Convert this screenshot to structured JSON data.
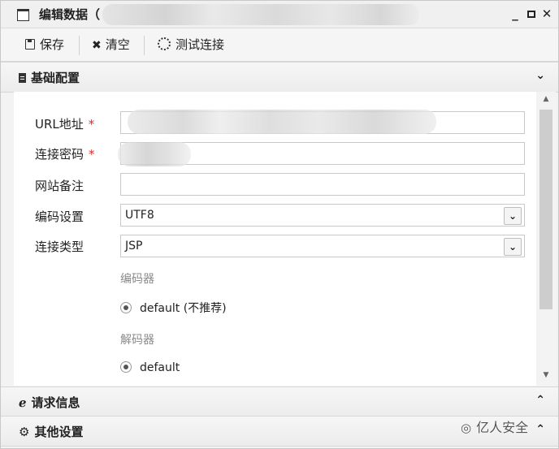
{
  "window": {
    "title": "编辑数据（"
  },
  "toolbar": {
    "save_label": "保存",
    "clear_label": "清空",
    "test_label": "测试连接"
  },
  "sections": {
    "basic": "基础配置",
    "request": "请求信息",
    "other": "其他设置"
  },
  "form": {
    "url_label": "URL地址",
    "password_label": "连接密码",
    "note_label": "网站备注",
    "encoding_label": "编码设置",
    "encoding_value": "UTF8",
    "type_label": "连接类型",
    "type_value": "JSP",
    "encoder_label": "编码器",
    "encoder_option": "default (不推荐)",
    "decoder_label": "解码器",
    "decoder_option": "default",
    "required_mark": "*"
  },
  "watermark": "亿人安全",
  "icons": {
    "window": "window-icon",
    "save": "save-icon",
    "clear": "close-x-icon",
    "test": "spinner-icon",
    "basic": "document-icon",
    "request": "browser-e-icon",
    "other": "gears-icon"
  }
}
